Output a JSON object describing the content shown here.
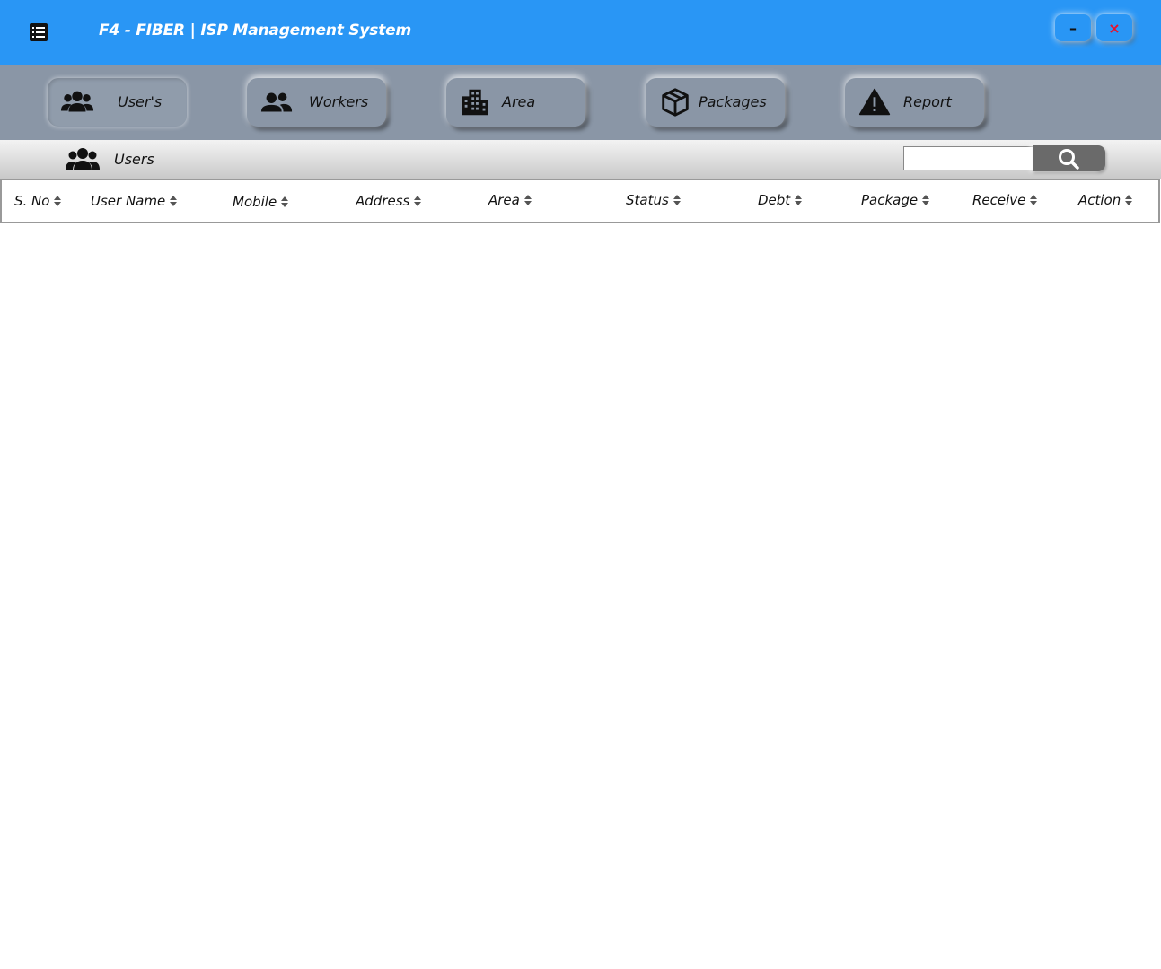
{
  "window": {
    "title": "F4 - FIBER | ISP Management System",
    "minimize_label": "–",
    "close_label": "×"
  },
  "nav": {
    "items": [
      {
        "label": "User's",
        "icon": "users-group-icon",
        "active": true
      },
      {
        "label": "Workers",
        "icon": "people-icon",
        "active": false
      },
      {
        "label": "Area",
        "icon": "building-icon",
        "active": false
      },
      {
        "label": "Packages",
        "icon": "package-box-icon",
        "active": false
      },
      {
        "label": "Report",
        "icon": "warning-icon",
        "active": false
      }
    ]
  },
  "section": {
    "title": "Users",
    "icon": "users-group-icon"
  },
  "search": {
    "value": "",
    "placeholder": "",
    "button_icon": "search-icon"
  },
  "table": {
    "columns": [
      "S. No",
      "User Name",
      "Mobile",
      "Address",
      "Area",
      "Status",
      "Debt",
      "Package",
      "Receive",
      "Action"
    ],
    "rows": []
  },
  "colors": {
    "titlebar": "#2996f5",
    "navband": "#8a96a6",
    "close": "#e8102a"
  }
}
